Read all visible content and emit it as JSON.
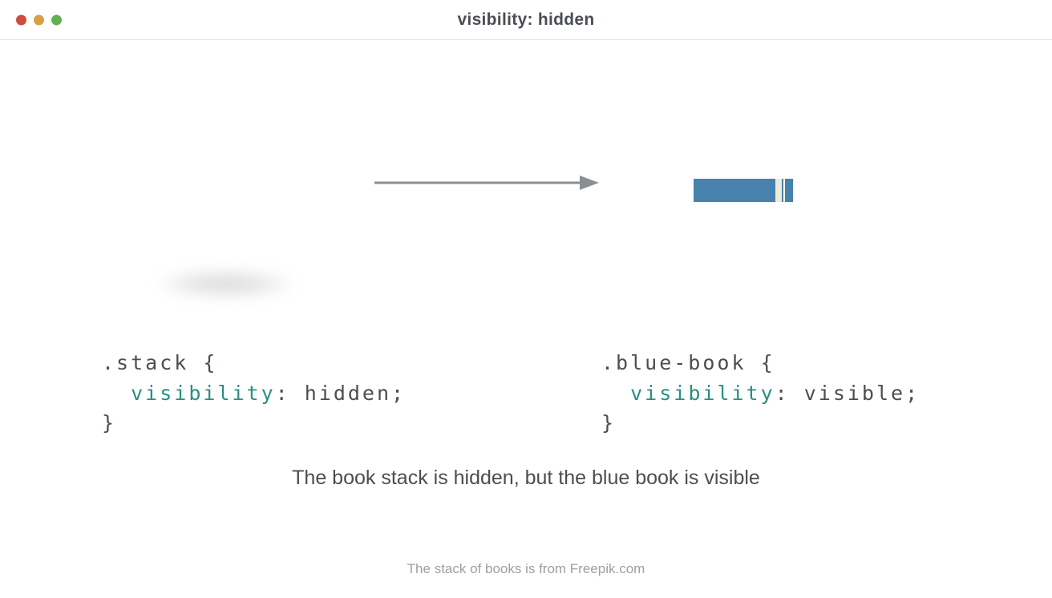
{
  "window": {
    "title": "visibility: hidden"
  },
  "code": {
    "left": {
      "selector": ".stack {",
      "prop": "visibility",
      "rest": ": hidden;",
      "close": "}"
    },
    "right": {
      "selector": ".blue-book {",
      "prop": "visibility",
      "rest": ": visible;",
      "close": "}"
    }
  },
  "caption": "The book stack is hidden, but the blue book is visible",
  "credit": "The stack of books is from Freepik.com",
  "colors": {
    "book_blue": "#4682ab",
    "code_keyword": "#2a8f82",
    "text": "#4a4e53",
    "muted": "#9aa0a6"
  }
}
